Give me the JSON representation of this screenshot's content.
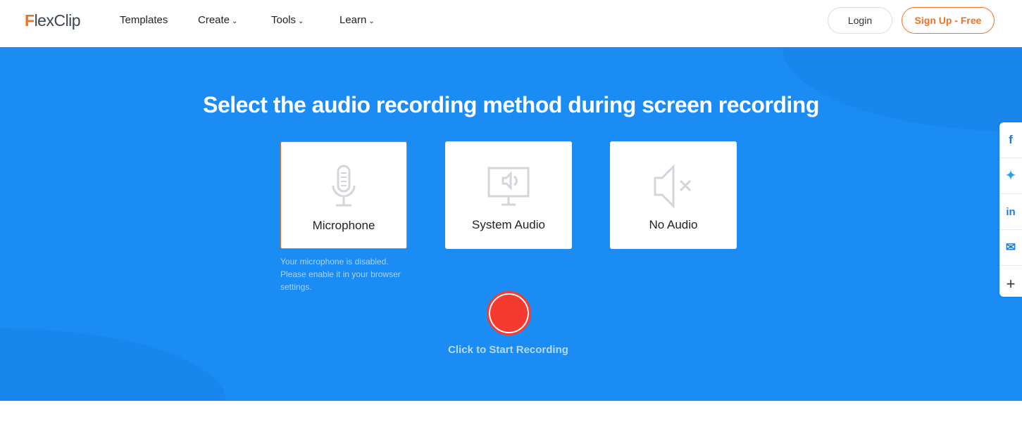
{
  "nav": {
    "logo": "FlexClip",
    "items": [
      "Templates",
      "Create",
      "Tools",
      "Learn"
    ],
    "login": "Login",
    "signup": "Sign Up - Free"
  },
  "hero": {
    "title": "Select the audio recording method during screen recording",
    "options": [
      {
        "label": "Microphone",
        "icon": "microphone-icon",
        "selected": true
      },
      {
        "label": "System Audio",
        "icon": "monitor-speaker-icon",
        "selected": false
      },
      {
        "label": "No Audio",
        "icon": "mute-icon",
        "selected": false
      }
    ],
    "mic_note": "Your microphone is disabled. Please enable it in your browser settings.",
    "record_label": "Click to Start Recording"
  },
  "share": {
    "icons": [
      "facebook-icon",
      "twitter-icon",
      "linkedin-icon",
      "email-icon",
      "plus-icon"
    ]
  },
  "colors": {
    "brand": "#f36f21",
    "hero_bg": "#1a8cf4",
    "record": "#f53a30"
  }
}
